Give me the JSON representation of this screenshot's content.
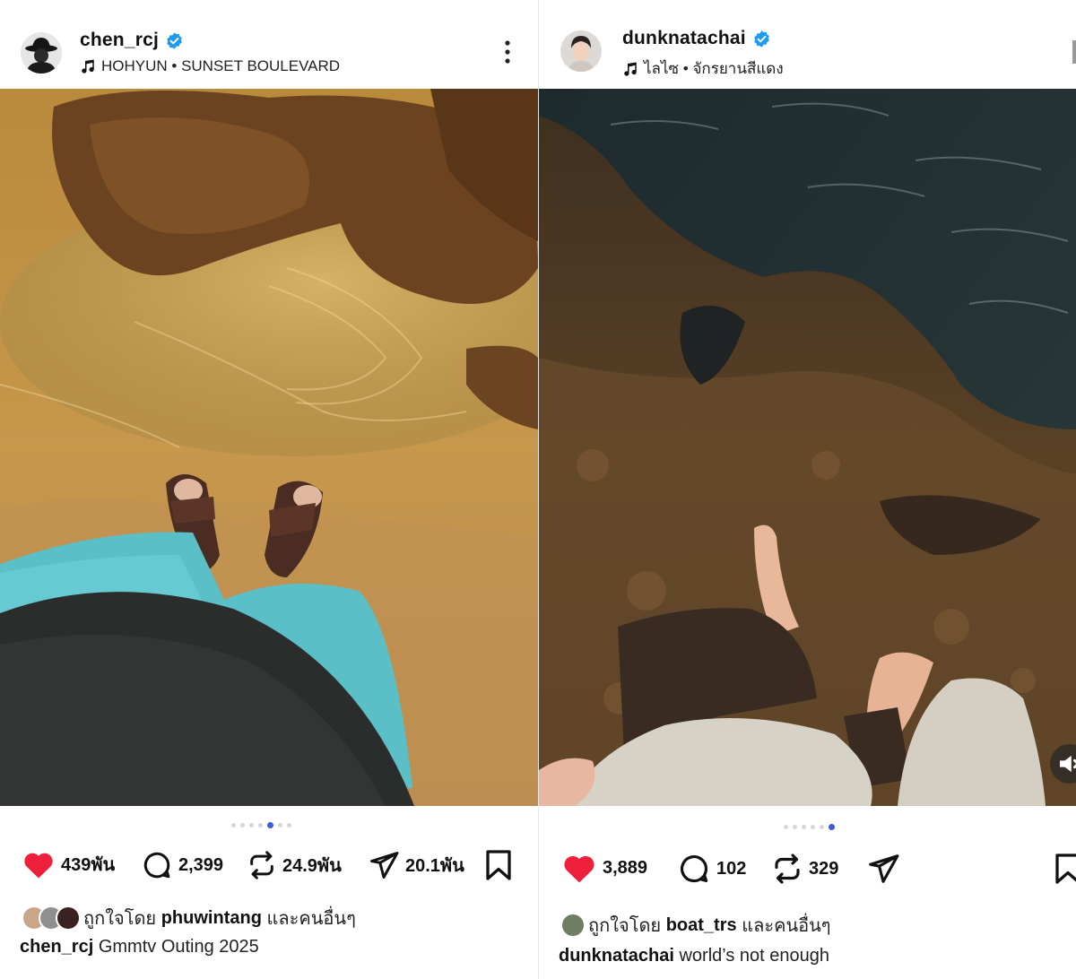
{
  "colors": {
    "verified": "#1d9bf0",
    "like_red": "#ed1f3a",
    "active_dot": "#3b5bdb",
    "inactive_dot": "#d6d6d6"
  },
  "posts": [
    {
      "username": "chen_rcj",
      "verified": true,
      "music": "HOHYUN • SUNSET BOULEVARD",
      "carousel": {
        "count": 7,
        "active_index": 4
      },
      "likes": "439พัน",
      "comments": "2,399",
      "reposts": "24.9พัน",
      "shares": "20.1พัน",
      "liked_by_prefix": "ถูกใจโดย",
      "liked_by_user": "phuwintang",
      "liked_by_suffix": "และคนอื่นๆ",
      "caption_user": "chen_rcj",
      "caption_text": "Gmmtv Outing 2025",
      "icons": [
        "music-note-icon",
        "more-vertical-icon",
        "heart-filled-icon",
        "comment-icon",
        "repost-icon",
        "share-send-icon",
        "bookmark-icon"
      ]
    },
    {
      "username": "dunknatachai",
      "verified": true,
      "music": "ไลไซ • จักรยานสีแดง",
      "carousel": {
        "count": 6,
        "active_index": 5
      },
      "likes": "3,889",
      "comments": "102",
      "reposts": "329",
      "liked_by_prefix": "ถูกใจโดย",
      "liked_by_user": "boat_trs",
      "liked_by_suffix": "และคนอื่นๆ",
      "caption_user": "dunknatachai",
      "caption_text": "world’s not enough",
      "icons": [
        "music-note-icon",
        "heart-filled-icon",
        "comment-icon",
        "repost-icon",
        "share-send-icon",
        "bookmark-icon",
        "speaker-muted-icon"
      ]
    }
  ]
}
